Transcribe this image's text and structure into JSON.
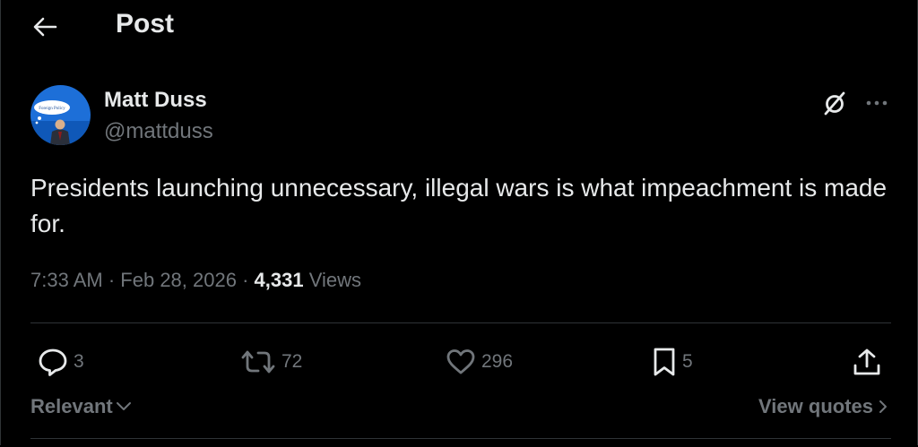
{
  "header": {
    "title": "Post"
  },
  "author": {
    "name": "Matt Duss",
    "handle": "@mattduss",
    "avatar_badge": "Foreign Policy"
  },
  "post": {
    "text": "Presidents launching unnecessary, illegal wars is what impeachment is made for.",
    "time": "7:33 AM",
    "date": "Feb 28, 2026",
    "separator": "·",
    "views_count": "4,331",
    "views_label": "Views"
  },
  "actions": {
    "replies": "3",
    "reposts": "72",
    "likes": "296",
    "bookmarks": "5"
  },
  "footer": {
    "sort_label": "Relevant",
    "quotes_label": "View quotes"
  },
  "icons": {
    "back": "arrow-left-icon",
    "grok": "grok-icon",
    "more": "more-horizontal-icon",
    "reply": "speech-bubble-icon",
    "repost": "repost-arrows-icon",
    "like": "heart-icon",
    "bookmark": "bookmark-icon",
    "share": "share-upload-icon"
  },
  "colors": {
    "background": "#000000",
    "text_primary": "#e7e9ea",
    "text_secondary": "#71767b",
    "divider": "#2f3336"
  }
}
